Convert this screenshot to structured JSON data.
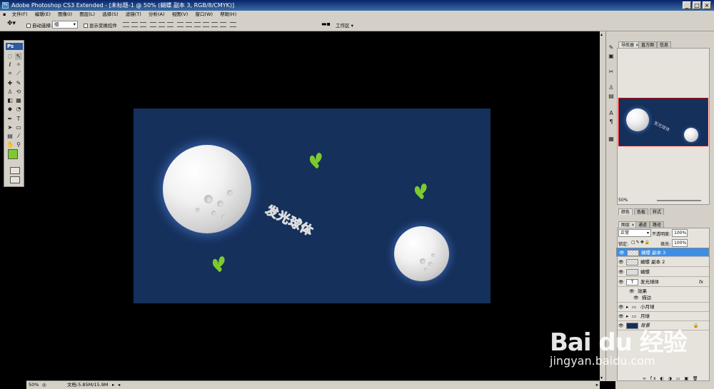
{
  "window": {
    "title": "Adobe Photoshop CS3 Extended - [未标题-1 @ 50% (蝴蝶 副本 3, RGB/8/CMYK)]",
    "buttons": [
      "_",
      "□",
      "×"
    ]
  },
  "menu": [
    "文件(F)",
    "编辑(E)",
    "图像(I)",
    "图层(L)",
    "选择(S)",
    "滤镜(T)",
    "分析(A)",
    "视图(V)",
    "窗口(W)",
    "帮助(H)"
  ],
  "options": {
    "auto_select_label": "自动选择:",
    "auto_select_value": "组",
    "show_transform_label": "显示变换控件",
    "workspace_label": "工作区 ▾"
  },
  "toolbox": {
    "logo": "Ps"
  },
  "canvas": {
    "text": "发光球体",
    "bg_color": "#15305b",
    "butterfly_color": "#7ccb2b"
  },
  "status": {
    "zoom": "50%",
    "doc": "文档:5.85M/15.9M"
  },
  "panels": {
    "nav_tabs": [
      "导航器 ×",
      "直方图",
      "信息"
    ],
    "nav_zoom": "50%",
    "color_tabs": [
      "颜色",
      "色板",
      "样式"
    ],
    "layer_tabs": [
      "图层 ×",
      "通道",
      "路径"
    ],
    "blend_mode": "正常",
    "opacity_label": "不透明度:",
    "opacity_value": "100%",
    "lock_label": "锁定:",
    "fill_label": "填充:",
    "fill_value": "100%",
    "layers": [
      {
        "name": "蝴蝶 副本 3",
        "selected": true
      },
      {
        "name": "蝴蝶 副本 2",
        "selected": false
      },
      {
        "name": "蝴蝶",
        "selected": false
      },
      {
        "name": "发光球体",
        "fx": "fx",
        "thumb": "T"
      },
      {
        "name": "效果"
      },
      {
        "name": "描边"
      },
      {
        "name": "小月球"
      },
      {
        "name": "月球"
      },
      {
        "name": "背景"
      }
    ]
  },
  "watermark": {
    "logo": "Bai du 经验",
    "url": "jingyan.baidu.com"
  }
}
